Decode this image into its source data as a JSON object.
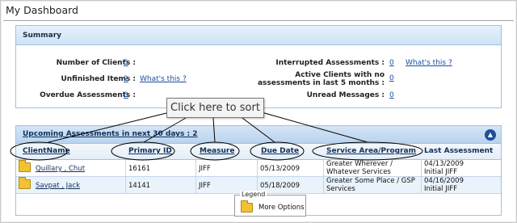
{
  "page": {
    "title": "My Dashboard"
  },
  "summary": {
    "title": "Summary",
    "number_of_clients_label": "Number of Clients :",
    "number_of_clients_value": "5",
    "unfinished_items_label": "Unfinished Items :",
    "unfinished_items_value": "2",
    "unfinished_whats_this": "What's this ?",
    "overdue_label": "Overdue Assessments :",
    "overdue_value": "0",
    "interrupted_label": "Interrupted Assessments :",
    "interrupted_value": "0",
    "interrupted_whats_this": "What's this ?",
    "inactive_label_line1": "Active Clients with no",
    "inactive_label_line2": "assessments in last 5 months :",
    "inactive_value": "0",
    "unread_label": "Unread Messages :",
    "unread_value": "0"
  },
  "upcoming": {
    "title": "Upcoming Assessments in next 30 days : 2",
    "columns": [
      "ClientName",
      "Primary ID",
      "Measure",
      "Due Date",
      "Service Area/Program",
      "Last Assessment"
    ],
    "rows": [
      {
        "client": "Quillary , Chut",
        "primary_id": "16161",
        "measure": "JIFF",
        "due_date": "05/13/2009",
        "service_area": "Greater Wherever / Whatever Services",
        "last_assessment": "04/13/2009 Initial JIFF"
      },
      {
        "client": "Savpat , Jack",
        "primary_id": "14141",
        "measure": "JIFF",
        "due_date": "05/18/2009",
        "service_area": "Greater Some Place / GSP Services",
        "last_assessment": "04/16/2009 Initial JIFF"
      }
    ]
  },
  "legend": {
    "title": "Legend",
    "item": "More Options"
  },
  "annotation": {
    "text": "Click here to sort"
  }
}
